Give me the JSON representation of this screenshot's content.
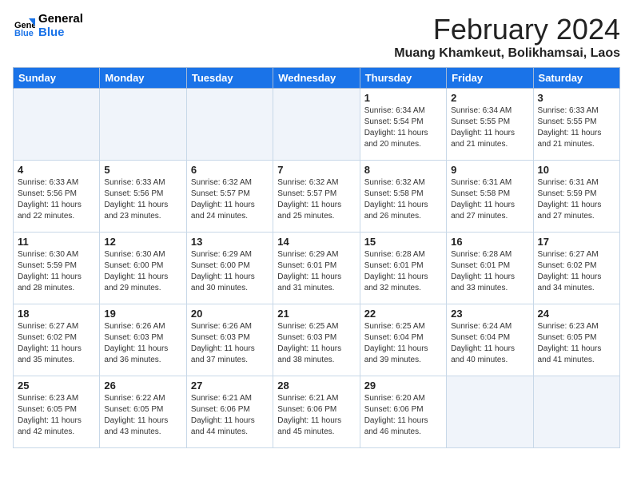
{
  "app": {
    "logo_line1": "General",
    "logo_line2": "Blue"
  },
  "header": {
    "month_year": "February 2024",
    "location": "Muang Khamkeut, Bolikhamsai, Laos"
  },
  "weekdays": [
    "Sunday",
    "Monday",
    "Tuesday",
    "Wednesday",
    "Thursday",
    "Friday",
    "Saturday"
  ],
  "weeks": [
    [
      {
        "day": "",
        "info": ""
      },
      {
        "day": "",
        "info": ""
      },
      {
        "day": "",
        "info": ""
      },
      {
        "day": "",
        "info": ""
      },
      {
        "day": "1",
        "info": "Sunrise: 6:34 AM\nSunset: 5:54 PM\nDaylight: 11 hours\nand 20 minutes."
      },
      {
        "day": "2",
        "info": "Sunrise: 6:34 AM\nSunset: 5:55 PM\nDaylight: 11 hours\nand 21 minutes."
      },
      {
        "day": "3",
        "info": "Sunrise: 6:33 AM\nSunset: 5:55 PM\nDaylight: 11 hours\nand 21 minutes."
      }
    ],
    [
      {
        "day": "4",
        "info": "Sunrise: 6:33 AM\nSunset: 5:56 PM\nDaylight: 11 hours\nand 22 minutes."
      },
      {
        "day": "5",
        "info": "Sunrise: 6:33 AM\nSunset: 5:56 PM\nDaylight: 11 hours\nand 23 minutes."
      },
      {
        "day": "6",
        "info": "Sunrise: 6:32 AM\nSunset: 5:57 PM\nDaylight: 11 hours\nand 24 minutes."
      },
      {
        "day": "7",
        "info": "Sunrise: 6:32 AM\nSunset: 5:57 PM\nDaylight: 11 hours\nand 25 minutes."
      },
      {
        "day": "8",
        "info": "Sunrise: 6:32 AM\nSunset: 5:58 PM\nDaylight: 11 hours\nand 26 minutes."
      },
      {
        "day": "9",
        "info": "Sunrise: 6:31 AM\nSunset: 5:58 PM\nDaylight: 11 hours\nand 27 minutes."
      },
      {
        "day": "10",
        "info": "Sunrise: 6:31 AM\nSunset: 5:59 PM\nDaylight: 11 hours\nand 27 minutes."
      }
    ],
    [
      {
        "day": "11",
        "info": "Sunrise: 6:30 AM\nSunset: 5:59 PM\nDaylight: 11 hours\nand 28 minutes."
      },
      {
        "day": "12",
        "info": "Sunrise: 6:30 AM\nSunset: 6:00 PM\nDaylight: 11 hours\nand 29 minutes."
      },
      {
        "day": "13",
        "info": "Sunrise: 6:29 AM\nSunset: 6:00 PM\nDaylight: 11 hours\nand 30 minutes."
      },
      {
        "day": "14",
        "info": "Sunrise: 6:29 AM\nSunset: 6:01 PM\nDaylight: 11 hours\nand 31 minutes."
      },
      {
        "day": "15",
        "info": "Sunrise: 6:28 AM\nSunset: 6:01 PM\nDaylight: 11 hours\nand 32 minutes."
      },
      {
        "day": "16",
        "info": "Sunrise: 6:28 AM\nSunset: 6:01 PM\nDaylight: 11 hours\nand 33 minutes."
      },
      {
        "day": "17",
        "info": "Sunrise: 6:27 AM\nSunset: 6:02 PM\nDaylight: 11 hours\nand 34 minutes."
      }
    ],
    [
      {
        "day": "18",
        "info": "Sunrise: 6:27 AM\nSunset: 6:02 PM\nDaylight: 11 hours\nand 35 minutes."
      },
      {
        "day": "19",
        "info": "Sunrise: 6:26 AM\nSunset: 6:03 PM\nDaylight: 11 hours\nand 36 minutes."
      },
      {
        "day": "20",
        "info": "Sunrise: 6:26 AM\nSunset: 6:03 PM\nDaylight: 11 hours\nand 37 minutes."
      },
      {
        "day": "21",
        "info": "Sunrise: 6:25 AM\nSunset: 6:03 PM\nDaylight: 11 hours\nand 38 minutes."
      },
      {
        "day": "22",
        "info": "Sunrise: 6:25 AM\nSunset: 6:04 PM\nDaylight: 11 hours\nand 39 minutes."
      },
      {
        "day": "23",
        "info": "Sunrise: 6:24 AM\nSunset: 6:04 PM\nDaylight: 11 hours\nand 40 minutes."
      },
      {
        "day": "24",
        "info": "Sunrise: 6:23 AM\nSunset: 6:05 PM\nDaylight: 11 hours\nand 41 minutes."
      }
    ],
    [
      {
        "day": "25",
        "info": "Sunrise: 6:23 AM\nSunset: 6:05 PM\nDaylight: 11 hours\nand 42 minutes."
      },
      {
        "day": "26",
        "info": "Sunrise: 6:22 AM\nSunset: 6:05 PM\nDaylight: 11 hours\nand 43 minutes."
      },
      {
        "day": "27",
        "info": "Sunrise: 6:21 AM\nSunset: 6:06 PM\nDaylight: 11 hours\nand 44 minutes."
      },
      {
        "day": "28",
        "info": "Sunrise: 6:21 AM\nSunset: 6:06 PM\nDaylight: 11 hours\nand 45 minutes."
      },
      {
        "day": "29",
        "info": "Sunrise: 6:20 AM\nSunset: 6:06 PM\nDaylight: 11 hours\nand 46 minutes."
      },
      {
        "day": "",
        "info": ""
      },
      {
        "day": "",
        "info": ""
      }
    ]
  ]
}
